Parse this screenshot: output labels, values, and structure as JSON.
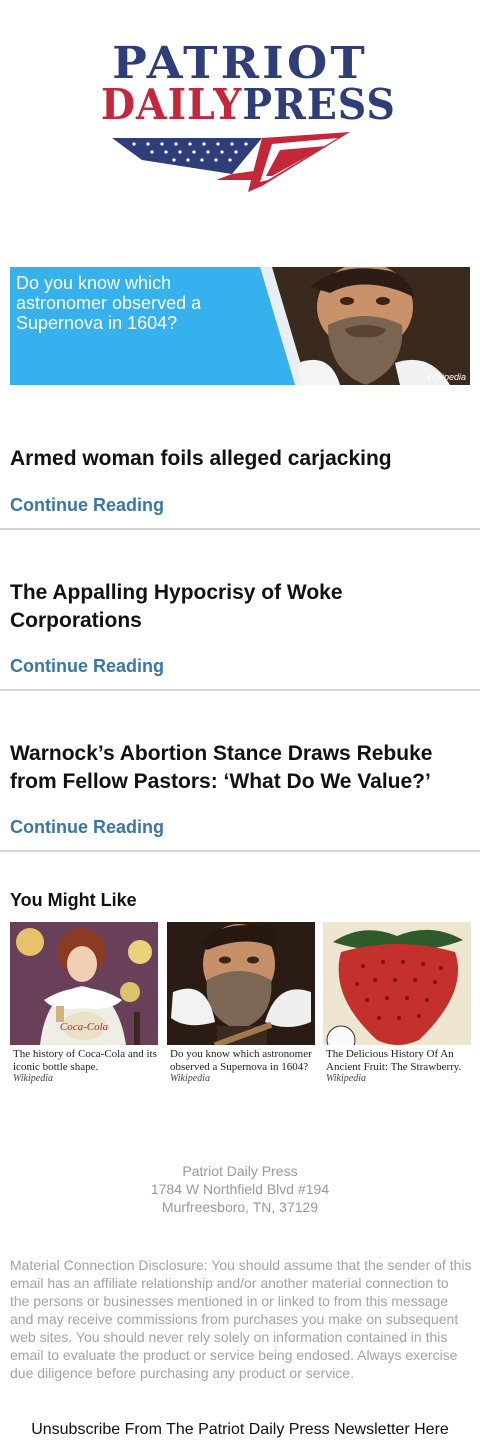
{
  "brand": {
    "logo_line1": "PATRIOT",
    "logo_line2_a": "DAILY",
    "logo_line2_b": "PRESS",
    "colors": {
      "navy": "#2f3d78",
      "red": "#c4273a",
      "link": "#3a76a8",
      "banner_blue": "#35b2ee"
    }
  },
  "ad_banner": {
    "question": "Do you know which astronomer observed a Supernova in 1604?",
    "credit": "Wikipedia"
  },
  "articles": [
    {
      "title": "Armed woman foils alleged carjacking",
      "link_label": "Continue Reading"
    },
    {
      "title": "The Appalling Hypocrisy of Woke Corporations",
      "link_label": "Continue Reading"
    },
    {
      "title": "Warnock’s Abortion Stance Draws Rebuke from Fellow Pastors: ‘What Do We Value?’",
      "link_label": "Continue Reading"
    }
  ],
  "you_might_like": {
    "heading": "You Might Like",
    "cards": [
      {
        "caption": "The history of Coca-Cola and its iconic bottle shape.",
        "source": "Wikipedia"
      },
      {
        "caption": "Do you know which astronomer observed a Supernova in 1604?",
        "source": "Wikipedia"
      },
      {
        "caption": "The Delicious History Of An Ancient Fruit: The Strawberry.",
        "source": "Wikipedia"
      }
    ]
  },
  "footer": {
    "company": "Patriot Daily Press",
    "street": "1784 W Northfield Blvd #194",
    "city": "Murfreesboro, TN, 37129",
    "disclosure": "Material Connection Disclosure: You should assume that the sender of this email has an affiliate relationship and/or another material connection to the persons or businesses mentioned in or linked to from this message and may receive commissions from purchases you make on subsequent web sites. You should never rely solely on information contained in this email to evaluate the product or service being endosed. Always exercise due diligence before purchasing any product or service.",
    "unsubscribe": "Unsubscribe From The Patriot Daily Press Newsletter Here"
  }
}
